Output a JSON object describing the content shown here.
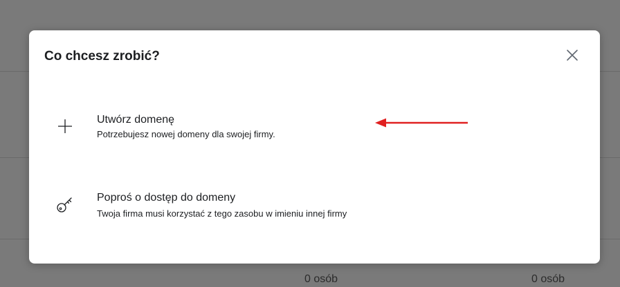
{
  "background": {
    "col1_value": "0 osób",
    "col2_value": "0 osób"
  },
  "modal": {
    "title": "Co chcesz zrobić?",
    "close_icon": "close-icon",
    "options": [
      {
        "icon": "plus-icon",
        "title": "Utwórz domenę",
        "description": "Potrzebujesz nowej domeny dla swojej firmy."
      },
      {
        "icon": "key-icon",
        "title": "Poproś o dostęp do domeny",
        "description": "Twoja firma musi korzystać z tego zasobu w imieniu innej firmy"
      }
    ]
  },
  "annotation": {
    "arrow_color": "#e02020"
  }
}
